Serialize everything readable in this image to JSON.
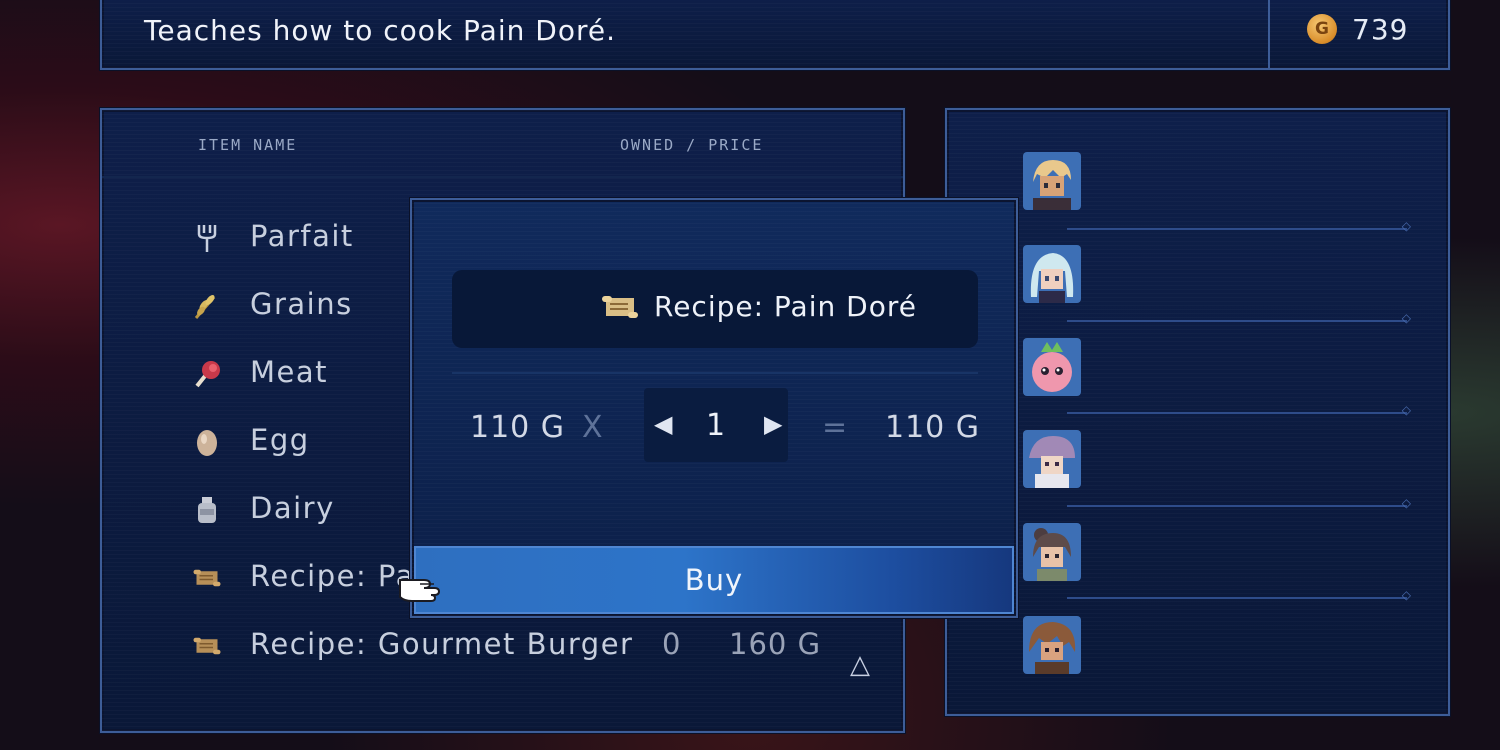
{
  "top_bar": {
    "description": "Teaches how to cook Pain Doré.",
    "gold": "739",
    "gold_icon_label": "G"
  },
  "list": {
    "header_name": "ITEM NAME",
    "header_price": "OWNED / PRICE",
    "items": [
      {
        "icon": "fork-icon",
        "name": "Parfait",
        "owned": "",
        "price": ""
      },
      {
        "icon": "grain-icon",
        "name": "Grains",
        "owned": "",
        "price": ""
      },
      {
        "icon": "meat-icon",
        "name": "Meat",
        "owned": "",
        "price": ""
      },
      {
        "icon": "egg-icon",
        "name": "Egg",
        "owned": "",
        "price": ""
      },
      {
        "icon": "dairy-icon",
        "name": "Dairy",
        "owned": "",
        "price": ""
      },
      {
        "icon": "recipe-scroll-icon",
        "name": "Recipe: Pa",
        "owned": "",
        "price": ""
      },
      {
        "icon": "recipe-scroll-icon",
        "name": "Recipe: Gourmet Burger",
        "owned": "0",
        "price": "160 G"
      }
    ],
    "scroll_glyph": "△"
  },
  "party": {
    "members": [
      {
        "icon": "party-member-blonde-icon",
        "color": "#d8b27a"
      },
      {
        "icon": "party-member-silver-hair-icon",
        "color": "#bfe0ea"
      },
      {
        "icon": "party-member-pink-creature-icon",
        "color": "#e27f9a"
      },
      {
        "icon": "party-member-purple-hat-icon",
        "color": "#a58bb8"
      },
      {
        "icon": "party-member-dark-hair-icon",
        "color": "#5d4b4a"
      },
      {
        "icon": "party-member-brown-hair-icon",
        "color": "#8b5a3a"
      }
    ]
  },
  "dialog": {
    "title": "Recipe: Pain Doré",
    "unit_price": "110 G",
    "multiplier": "X",
    "quantity": "1",
    "dec_glyph": "◀",
    "inc_glyph": "▶",
    "equals": "=",
    "total": "110 G",
    "buy_label": "Buy"
  },
  "colors": {
    "panel_bg": "#0e1f4a",
    "panel_border": "#3d5d98",
    "buy_button": "#2e6fc0",
    "gold_coin": "#d98d2a"
  }
}
